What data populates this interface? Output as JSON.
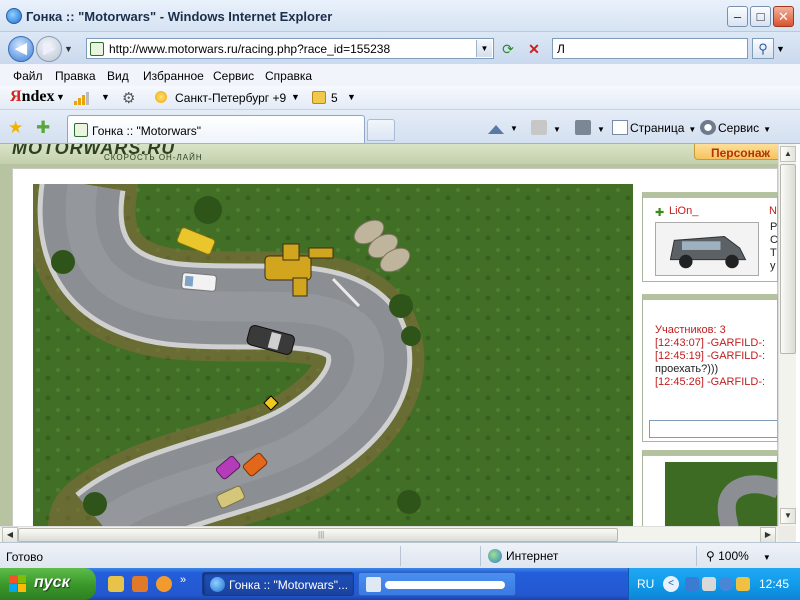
{
  "window": {
    "title": "Гонка :: \"Motorwars\" - Windows Internet Explorer",
    "controls": {
      "minimize": "–",
      "maximize": "□",
      "close": "✕"
    }
  },
  "address_bar": {
    "url": "http://www.motorwars.ru/racing.php?race_id=155238",
    "search_value": "Л"
  },
  "menu": {
    "items": [
      "Файл",
      "Правка",
      "Вид",
      "Избранное",
      "Сервис",
      "Справка"
    ]
  },
  "yandex_bar": {
    "logo_red": "Я",
    "logo_black": "ndex",
    "weather": "Санкт-Петербург +9",
    "mail_count": "5"
  },
  "tabs": {
    "active_label": "Гонка :: \"Motorwars\""
  },
  "command_bar": {
    "page": "Страница",
    "tools": "Сервис"
  },
  "site": {
    "logo": "MOTORWARS.RU",
    "tagline": "СКОРОСТЬ ОН-ЛАЙН",
    "personal_button": "Персонаж"
  },
  "user_card": {
    "username": "LiOn_",
    "flag_letter": "N",
    "side_letters": [
      "Р",
      "С",
      "Т",
      "у"
    ]
  },
  "chat": {
    "participants": "Участников: 3",
    "lines": [
      {
        "time": "[12:43:07] -GARFILD-:",
        "msg": ""
      },
      {
        "time": "[12:45:19] -GARFILD-:",
        "msg": ""
      },
      {
        "time": "",
        "msg": "проехать?)))"
      },
      {
        "time": "[12:45:26] -GARFILD-:",
        "msg": ""
      }
    ]
  },
  "status_bar": {
    "status": "Готово",
    "zone": "Интернет",
    "zoom": "100%"
  },
  "taskbar": {
    "start": "пуск",
    "ie_task": "Гонка :: \"Motorwars\"...",
    "language": "RU",
    "clock": "12:45"
  },
  "colors": {
    "grass": "#3f6b24",
    "road": "#8a8d90",
    "chat_red": "#c21d1d",
    "xp_taskbar": "#245edb",
    "xp_start": "#3a9a2b"
  }
}
